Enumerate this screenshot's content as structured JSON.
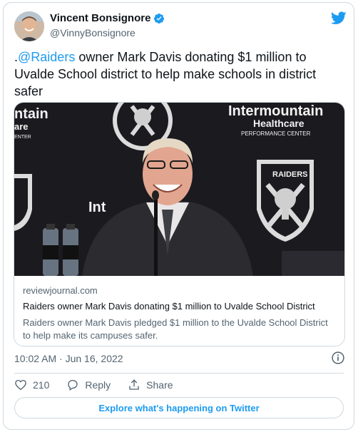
{
  "author": {
    "name": "Vincent Bonsignore",
    "handle": "@VinnyBonsignore"
  },
  "tweet": {
    "prefix": ".",
    "mention": "@Raiders",
    "text": " owner Mark Davis donating $1 million to Uvalde School district to help make schools in district safer"
  },
  "link_card": {
    "domain": "reviewjournal.com",
    "title": "Raiders owner Mark Davis donating $1 million to Uvalde School District",
    "description": "Raiders owner Mark Davis pledged $1 million to the Uvalde School District to help make its campuses safer.",
    "image_text": {
      "left_banner": "ntain",
      "left_banner2": "are",
      "left_banner3": "ENTER",
      "right_banner": "Intermountain",
      "right_banner2": "Healthcare",
      "right_banner3": "PERFORMANCE CENTER",
      "shield_label": "RAIDERS",
      "middle_text": "Int"
    }
  },
  "meta": {
    "timestamp": "10:02 AM · Jun 16, 2022"
  },
  "actions": {
    "likes": "210",
    "reply_label": "Reply",
    "share_label": "Share"
  },
  "explore_label": "Explore what's happening on Twitter",
  "colors": {
    "accent": "#1d9bf0",
    "text": "#0f1419",
    "muted": "#536471",
    "border": "#cfd9de"
  },
  "icons": [
    "verified-badge-icon",
    "twitter-bird-icon",
    "info-icon",
    "heart-icon",
    "reply-icon",
    "share-icon"
  ]
}
